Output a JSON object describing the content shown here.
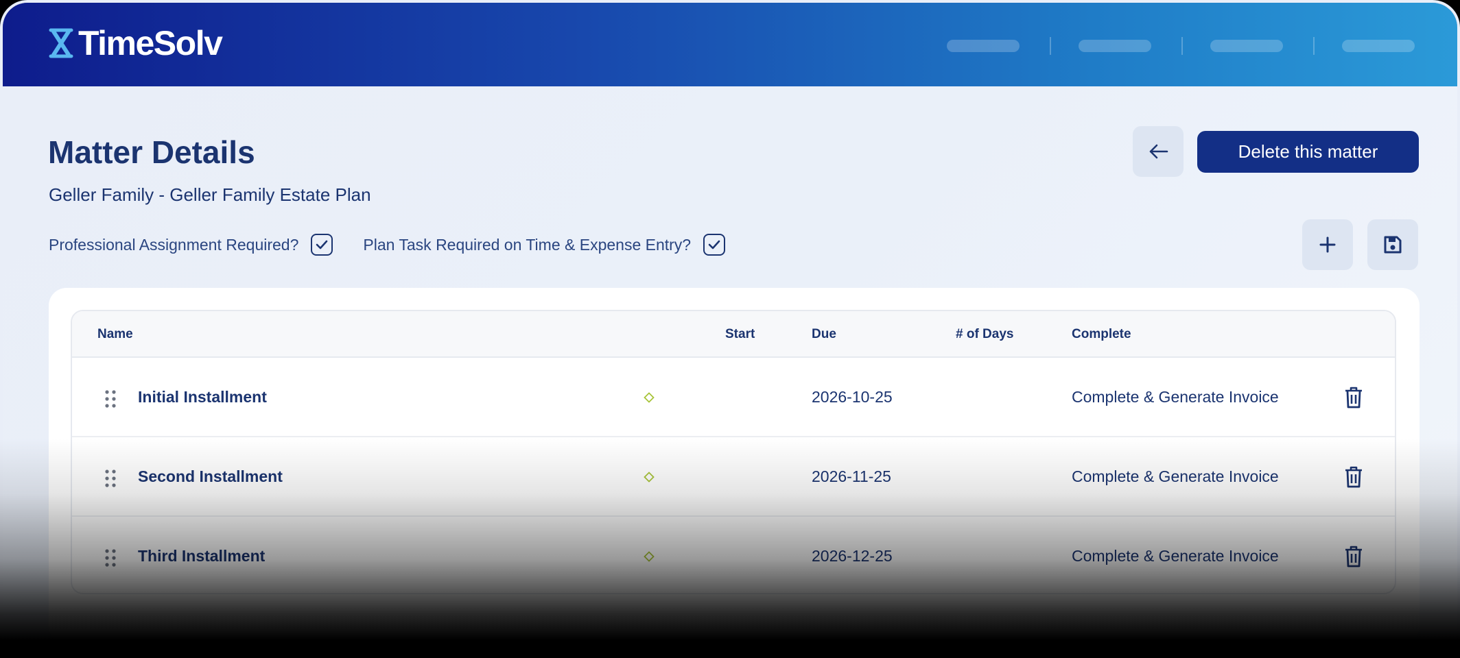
{
  "app": {
    "logo_text": "TimeSolv"
  },
  "page": {
    "title_light": "Matter ",
    "title_bold": "Details",
    "subtitle": "Geller Family - Geller Family Estate Plan",
    "delete_label": "Delete this matter"
  },
  "options": {
    "professional_label": "Professional Assignment Required?",
    "professional_checked": true,
    "plan_task_label": "Plan Task Required on Time & Expense Entry?",
    "plan_task_checked": true
  },
  "table": {
    "columns": {
      "name": "Name",
      "start": "Start",
      "due": "Due",
      "days": "# of Days",
      "complete": "Complete"
    },
    "rows": [
      {
        "name": "Initial Installment",
        "start": "",
        "due": "2026-10-25",
        "days": "",
        "complete": "Complete & Generate Invoice"
      },
      {
        "name": "Second Installment",
        "start": "",
        "due": "2026-11-25",
        "days": "",
        "complete": "Complete & Generate Invoice"
      },
      {
        "name": "Third Installment",
        "start": "",
        "due": "2026-12-25",
        "days": "",
        "complete": "Complete & Generate Invoice"
      }
    ]
  },
  "icons": {
    "back": "arrow-left-icon",
    "add": "plus-icon",
    "save": "save-icon",
    "drag": "drag-handle-icon",
    "milestone": "diamond-icon",
    "delete": "trash-icon"
  },
  "colors": {
    "brand_dark": "#132f86",
    "text": "#1b3470",
    "milestone": "#a8c43a"
  }
}
